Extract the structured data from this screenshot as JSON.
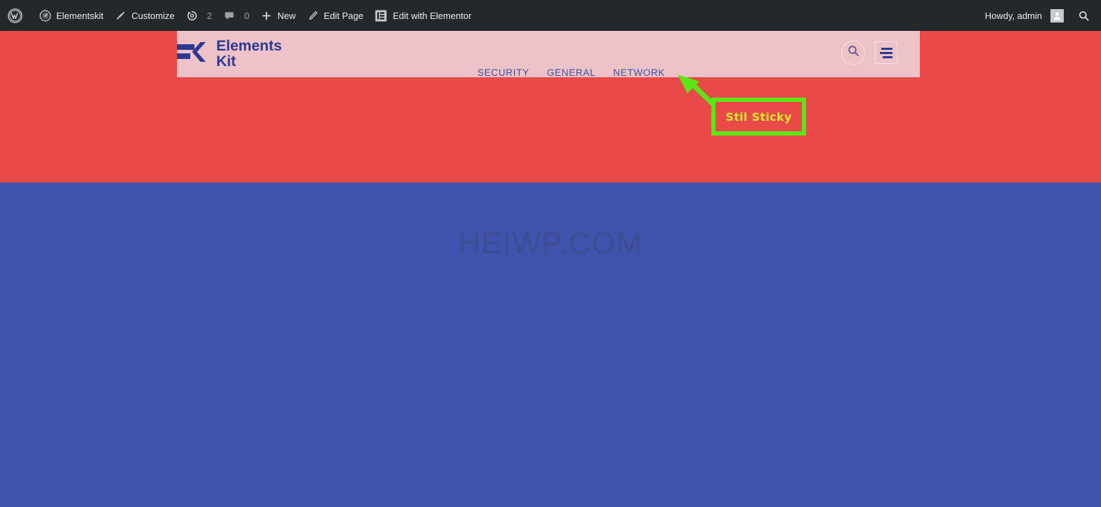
{
  "adminbar": {
    "left_items": [
      {
        "name": "wp-logo",
        "icon": "wordpress-icon",
        "label": ""
      },
      {
        "name": "site-name",
        "icon": "dashboard-icon",
        "label": "Elementskit"
      },
      {
        "name": "customize",
        "icon": "paintbrush-icon",
        "label": "Customize"
      },
      {
        "name": "updates",
        "icon": "update-icon",
        "label": "",
        "count": "2"
      },
      {
        "name": "comments",
        "icon": "comment-icon",
        "label": "",
        "count": "0"
      },
      {
        "name": "new-content",
        "icon": "plus-icon",
        "label": "New"
      },
      {
        "name": "edit-page",
        "icon": "pencil-icon",
        "label": "Edit Page"
      },
      {
        "name": "edit-with-elementor",
        "icon": "elementor-icon",
        "label": "Edit with Elementor"
      }
    ],
    "howdy": "Howdy, admin",
    "avatar_icon": "user-avatar-icon",
    "search_icon": "search-icon"
  },
  "header": {
    "logo": {
      "mark": "ek-logo-mark",
      "line1": "Elements",
      "line2": "Kit"
    },
    "nav": [
      {
        "label": "SECURITY"
      },
      {
        "label": "GENERAL"
      },
      {
        "label": "NETWORK"
      }
    ],
    "tools": {
      "search_icon": "search-icon",
      "menu_icon": "hamburger-menu-icon"
    },
    "colors": {
      "background": "#eec3c8",
      "text": "#2b3990",
      "nav_link": "#3f4e9c"
    }
  },
  "content": {
    "watermark": "HEIWP.COM",
    "colors": {
      "top_band": "#e84a48",
      "bottom_band": "#3f53ac",
      "watermark_text": "#3c4d92"
    }
  },
  "annotation": {
    "label": "Stil Sticky",
    "box_color": "#5ce615",
    "text_color": "#d7e82f",
    "arrow_color": "#5ce615"
  }
}
